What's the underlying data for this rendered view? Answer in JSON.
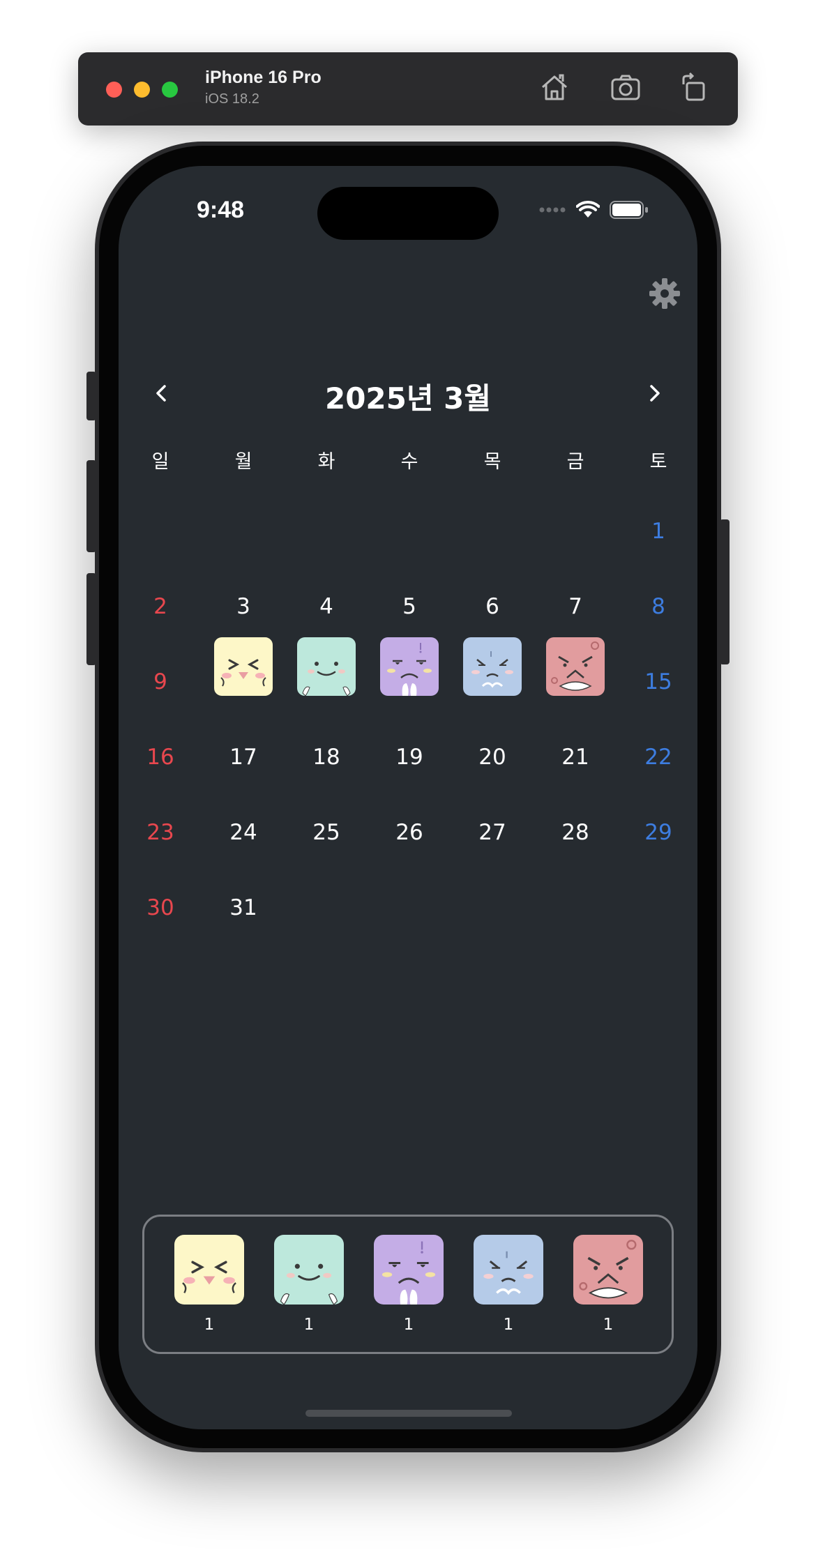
{
  "simulator": {
    "device_name": "iPhone 16 Pro",
    "os_version": "iOS 18.2",
    "icons": [
      "home-icon",
      "screenshot-icon",
      "rotate-icon"
    ]
  },
  "status_bar": {
    "time": "9:48"
  },
  "calendar": {
    "title": "2025년 3월",
    "prev_icon": "chevron-left-icon",
    "next_icon": "chevron-right-icon",
    "settings_icon": "gear-icon",
    "weekdays": [
      "일",
      "월",
      "화",
      "수",
      "목",
      "금",
      "토"
    ],
    "days": {
      "d1": "1",
      "d2": "2",
      "d3": "3",
      "d4": "4",
      "d5": "5",
      "d6": "6",
      "d7": "7",
      "d8": "8",
      "d9": "9",
      "d15": "15",
      "d16": "16",
      "d17": "17",
      "d18": "18",
      "d19": "19",
      "d20": "20",
      "d21": "21",
      "d22": "22",
      "d23": "23",
      "d24": "24",
      "d25": "25",
      "d26": "26",
      "d27": "27",
      "d28": "28",
      "d29": "29",
      "d30": "30",
      "d31": "31"
    },
    "mood_days": [
      {
        "day": 10,
        "mood": "happy"
      },
      {
        "day": 11,
        "mood": "calm"
      },
      {
        "day": 12,
        "mood": "annoyed"
      },
      {
        "day": 13,
        "mood": "sad"
      },
      {
        "day": 14,
        "mood": "angry"
      }
    ],
    "colors": {
      "sunday": "#e8474e",
      "saturday": "#3d7de0",
      "background": "#262b30"
    }
  },
  "mood_summary": {
    "items": [
      {
        "mood": "happy",
        "color": "#fdf7c8",
        "count": "1"
      },
      {
        "mood": "calm",
        "color": "#bde8dc",
        "count": "1"
      },
      {
        "mood": "annoyed",
        "color": "#c4ade6",
        "count": "1"
      },
      {
        "mood": "sad",
        "color": "#b5cbe8",
        "count": "1"
      },
      {
        "mood": "angry",
        "color": "#e19c9e",
        "count": "1"
      }
    ]
  }
}
